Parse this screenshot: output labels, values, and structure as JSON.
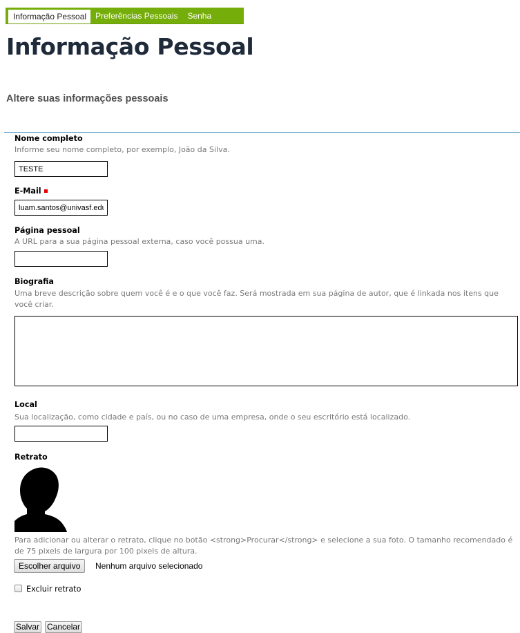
{
  "tabs": [
    {
      "label": "Informação Pessoal",
      "active": true
    },
    {
      "label": "Preferências Pessoais",
      "active": false
    },
    {
      "label": "Senha",
      "active": false
    }
  ],
  "page": {
    "title": "Informação Pessoal",
    "subtitle": "Altere suas informações pessoais"
  },
  "fields": {
    "fullname": {
      "label": "Nome completo",
      "help": "Informe seu nome completo, por exemplo, João da Silva.",
      "value": "TESTE"
    },
    "email": {
      "label": "E-Mail",
      "required": true,
      "value": "luam.santos@univasf.edu.br"
    },
    "homepage": {
      "label": "Página pessoal",
      "help": "A URL para a sua página pessoal externa, caso você possua uma.",
      "value": ""
    },
    "bio": {
      "label": "Biografia",
      "help": "Uma breve descrição sobre quem você é e o que você faz. Será mostrada em sua página de autor, que é linkada nos itens que você criar.",
      "value": ""
    },
    "location": {
      "label": "Local",
      "help": "Sua localização, como cidade e país, ou no caso de uma empresa, onde o seu escritório está localizado.",
      "value": ""
    },
    "portrait": {
      "label": "Retrato",
      "help": "Para adicionar ou alterar o retrato, clique no botão <strong>Procurar</strong> e selecione a sua foto. O tamanho recomendado é de 75 pixels de largura por 100 pixels de altura.",
      "file_button": "Escolher arquivo",
      "file_status": "Nenhum arquivo selecionado",
      "delete_label": "Excluir retrato",
      "delete_checked": false
    }
  },
  "actions": {
    "save": "Salvar",
    "cancel": "Cancelar"
  },
  "colors": {
    "tabbar": "#75ad0a",
    "divider": "#5aa3c9",
    "required": "#e00000"
  }
}
